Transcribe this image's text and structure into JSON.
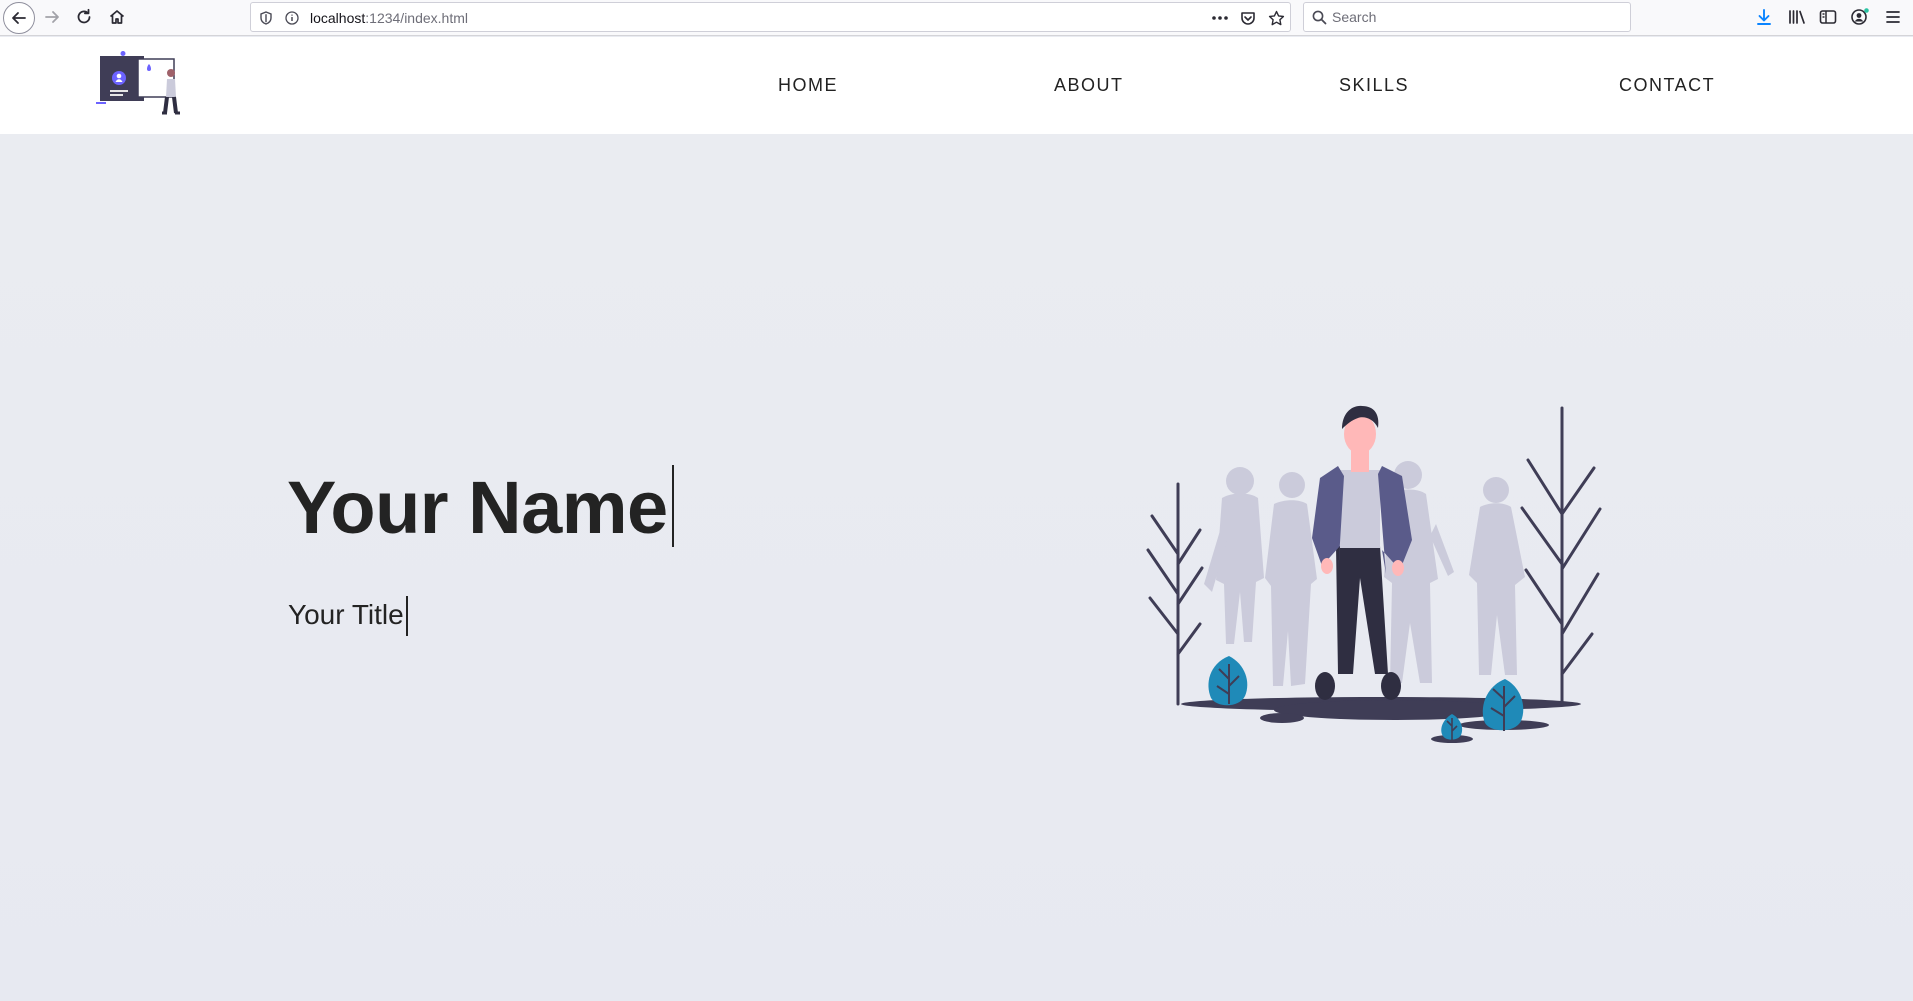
{
  "browser": {
    "url_host": "localhost",
    "url_path": ":1234/index.html",
    "search_placeholder": "Search"
  },
  "nav": {
    "home": "HOME",
    "about": "ABOUT",
    "skills": "SKILLS",
    "contact": "CONTACT"
  },
  "hero": {
    "name": "Your Name",
    "title": "Your Title"
  },
  "colors": {
    "hero_background": "#e9ebf1",
    "text": "#232323",
    "accent_leaf": "#1f8ab8",
    "jacket": "#5a5b8a",
    "shadow_people": "#cbcbdb",
    "dark": "#3f3d56"
  }
}
